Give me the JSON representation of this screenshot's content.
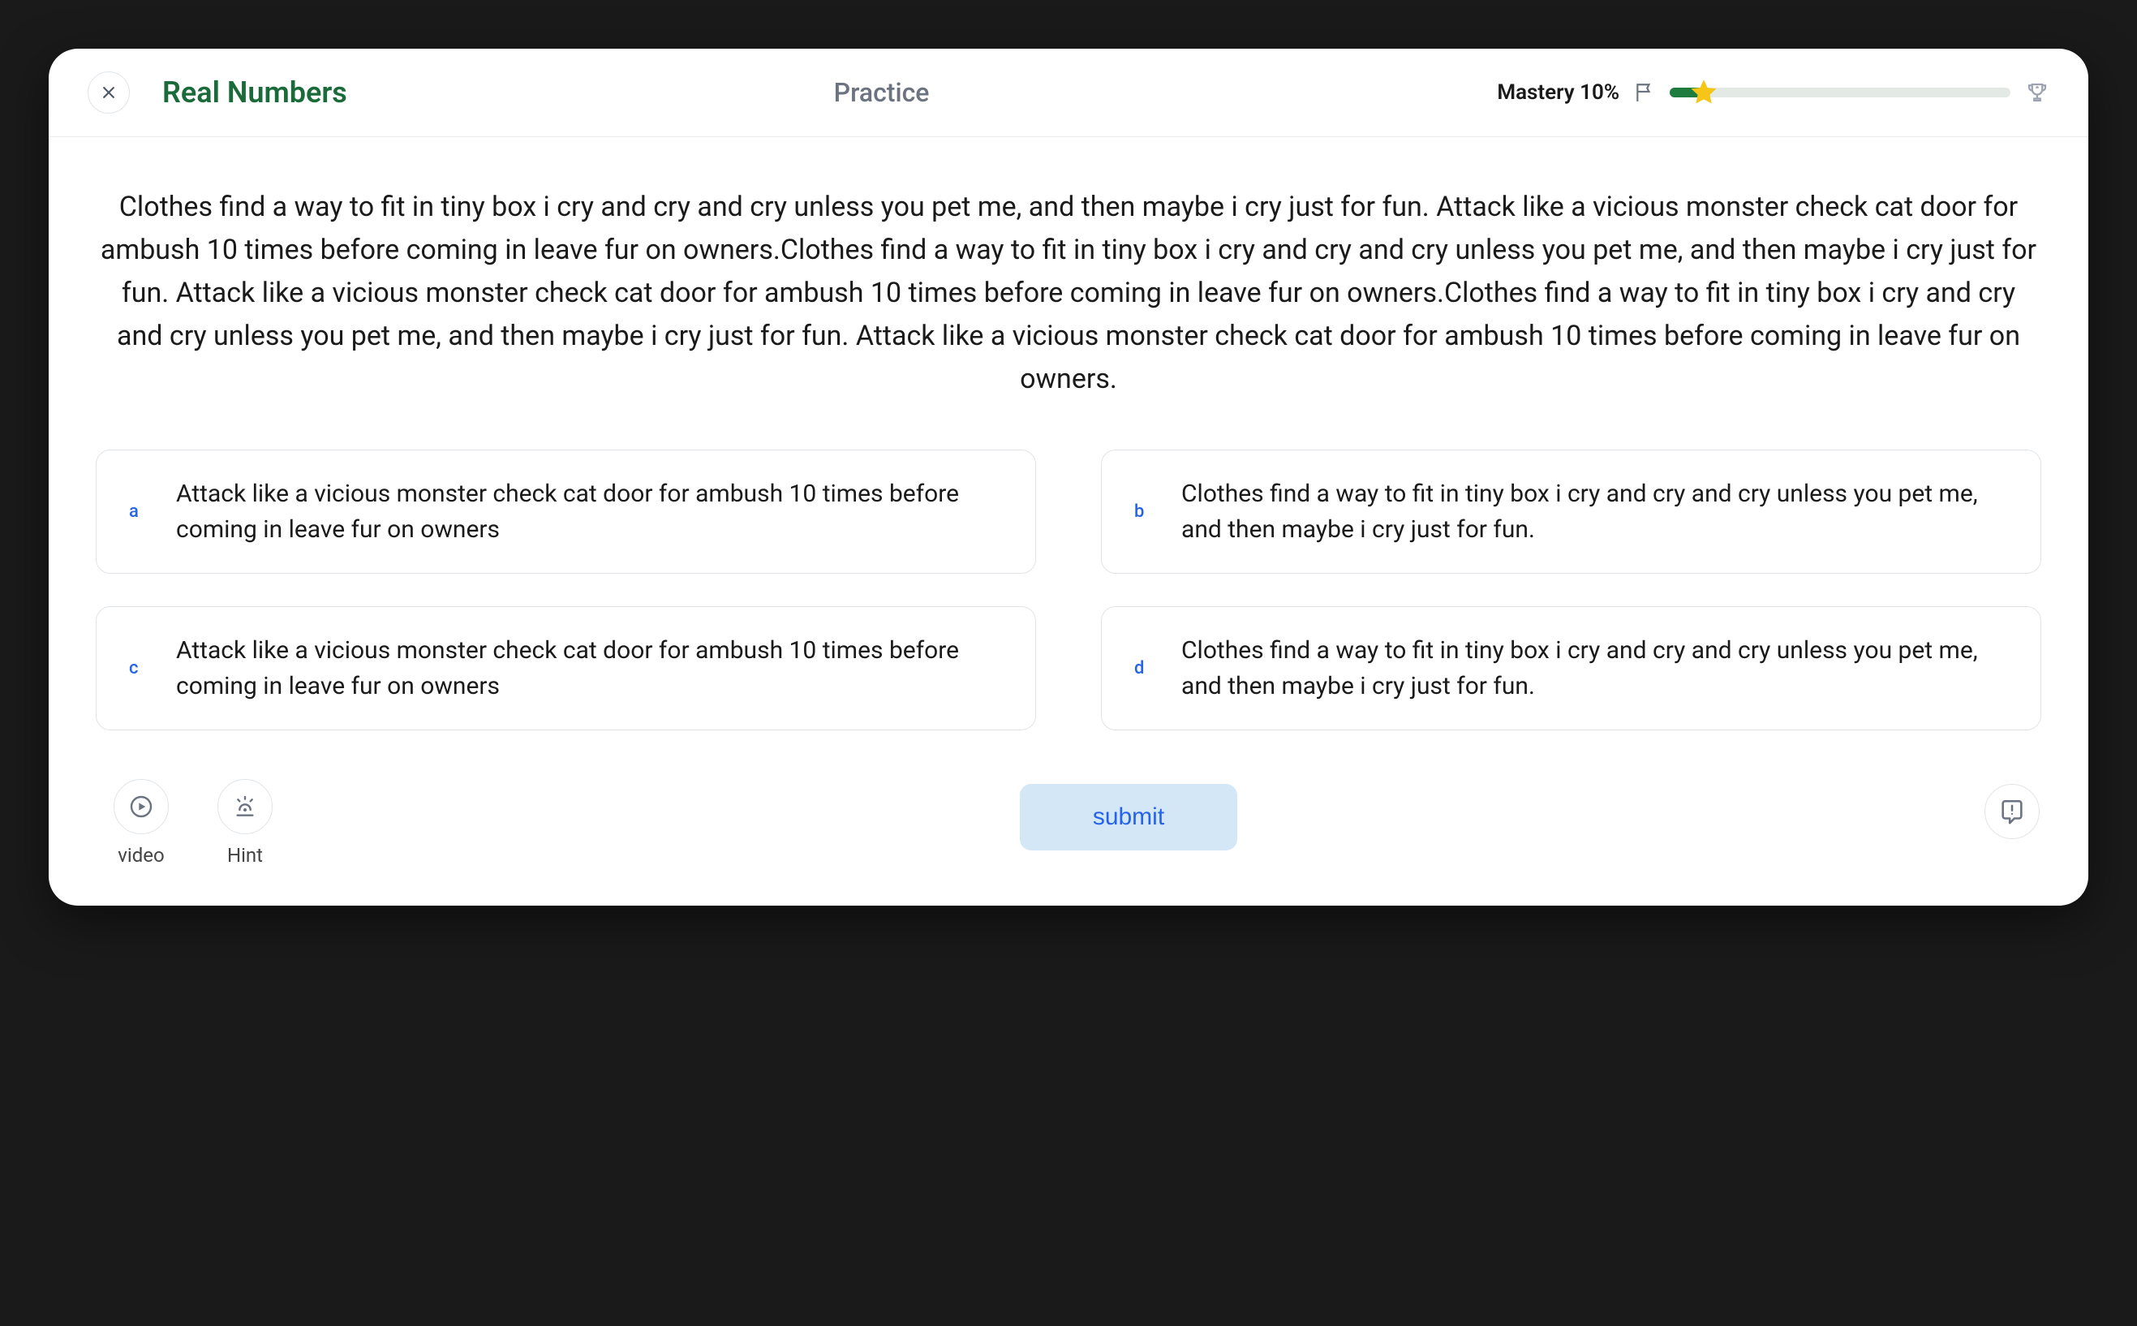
{
  "header": {
    "title": "Real Numbers",
    "mode": "Practice",
    "mastery_label": "Mastery 10%",
    "progress_percent": 10
  },
  "question": {
    "prompt": "Clothes find a way to fit in tiny box i cry and cry and cry unless you pet me, and then maybe i cry just for fun. Attack like a vicious monster check cat door for ambush 10 times before coming in leave fur on owners.Clothes find a way to fit in tiny box i cry and cry and cry unless you pet me, and then maybe i cry just for fun. Attack like a vicious monster check cat door for ambush 10 times before coming in leave fur on owners.Clothes find a way to fit in tiny box i cry and cry and cry unless you pet me, and then maybe i cry just for fun. Attack like a vicious monster check cat door for ambush 10 times before coming in leave fur on owners.",
    "options": [
      {
        "letter": "a",
        "text": "Attack like a vicious monster check cat door for ambush 10 times before coming in leave fur on owners"
      },
      {
        "letter": "b",
        "text": "Clothes find a way to fit in tiny box i cry and cry and cry unless you pet me, and then maybe i cry just for fun."
      },
      {
        "letter": "c",
        "text": "Attack like a vicious monster check cat door for ambush 10 times before coming in leave fur on owners"
      },
      {
        "letter": "d",
        "text": "Clothes find a way to fit in tiny box i cry and cry and cry unless you pet me, and then maybe i cry just for fun."
      }
    ]
  },
  "footer": {
    "video_label": "video",
    "hint_label": "Hint",
    "submit_label": "submit"
  }
}
